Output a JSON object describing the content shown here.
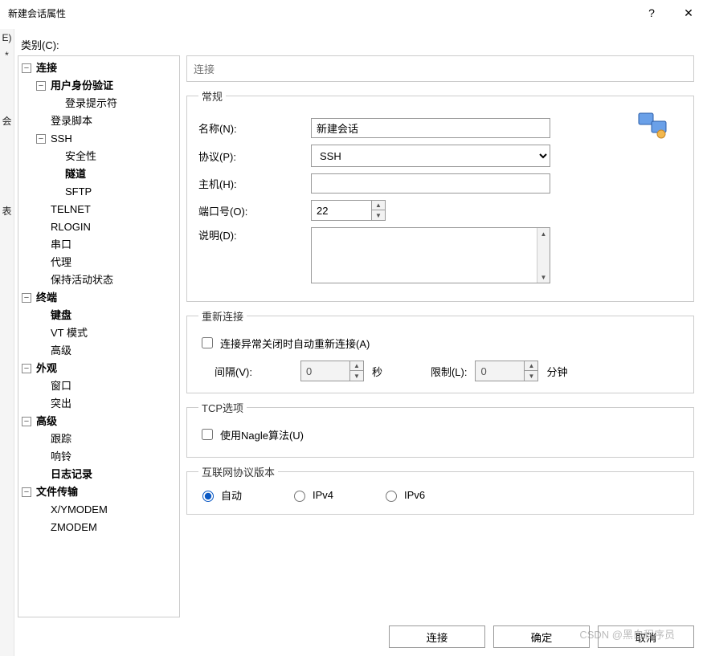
{
  "title": "新建会话属性",
  "left_edge": [
    "E)",
    "*",
    "会",
    "表"
  ],
  "category_label": "类别(C):",
  "section_header": "连接",
  "tree": {
    "connection": "连接",
    "auth": "用户身份验证",
    "login_prompt": "登录提示符",
    "login_script": "登录脚本",
    "ssh": "SSH",
    "security": "安全性",
    "tunnel": "隧道",
    "sftp": "SFTP",
    "telnet": "TELNET",
    "rlogin": "RLOGIN",
    "serial": "串口",
    "proxy": "代理",
    "keepalive": "保持活动状态",
    "terminal": "终端",
    "keyboard": "键盘",
    "vt": "VT 模式",
    "advanced_t": "高级",
    "appearance": "外观",
    "window": "窗口",
    "highlight": "突出",
    "advanced": "高级",
    "trace": "跟踪",
    "bell": "响铃",
    "logging": "日志记录",
    "file_transfer": "文件传输",
    "xymodem": "X/YMODEM",
    "zmodem": "ZMODEM"
  },
  "general": {
    "legend": "常规",
    "name_label": "名称(N):",
    "name_value": "新建会话",
    "proto_label": "协议(P):",
    "proto_value": "SSH",
    "host_label": "主机(H):",
    "host_value": "",
    "port_label": "端口号(O):",
    "port_value": "22",
    "desc_label": "说明(D):",
    "desc_value": ""
  },
  "reconnect": {
    "legend": "重新连接",
    "auto_label": "连接异常关闭时自动重新连接(A)",
    "interval_label": "间隔(V):",
    "interval_value": "0",
    "sec": "秒",
    "limit_label": "限制(L):",
    "limit_value": "0",
    "min": "分钟"
  },
  "tcp": {
    "legend": "TCP选项",
    "nagle_label": "使用Nagle算法(U)"
  },
  "ip": {
    "legend": "互联网协议版本",
    "auto": "自动",
    "ipv4": "IPv4",
    "ipv6": "IPv6"
  },
  "buttons": {
    "connect": "连接",
    "ok": "确定",
    "cancel": "取消"
  },
  "watermark": "CSDN @黑白程序员"
}
